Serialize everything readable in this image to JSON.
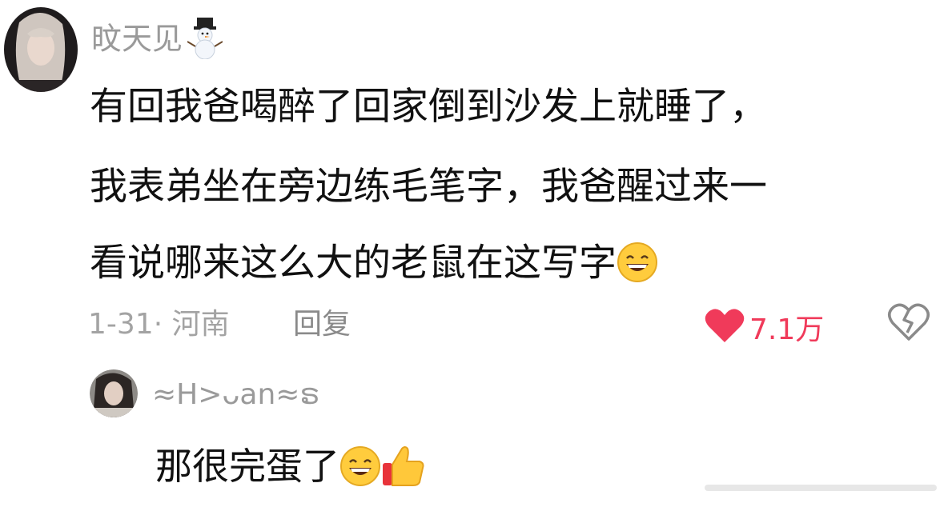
{
  "comment": {
    "username": "旼天见",
    "username_emoji": "snowman-icon",
    "text_lines": [
      "有回我爸喝醉了回家倒到沙发上就睡了，",
      "我表弟坐在旁边练毛笔字，我爸醒过来一",
      "看说哪来这么大的老鼠在这写字"
    ],
    "date_location": "1-31· 河南",
    "reply_label": "回复",
    "like_count": "7.1万",
    "colors": {
      "like": "#f03a5a",
      "meta": "#a3a3a3",
      "text": "#111111"
    }
  },
  "reply": {
    "username": "≈H>ᴗan≈ຣ",
    "text": "那很完蛋了",
    "emojis": [
      "grin-emoji",
      "thumbs-up-emoji"
    ]
  }
}
